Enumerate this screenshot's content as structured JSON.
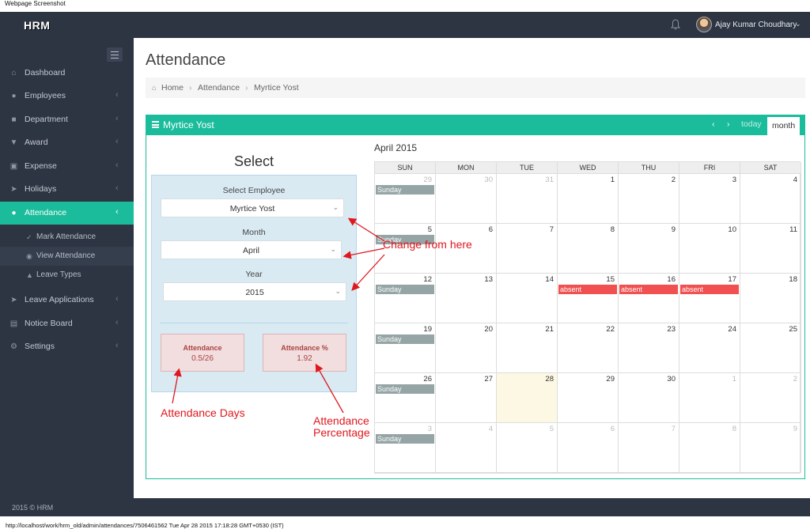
{
  "screenshot_caption": "Webpage Screenshot",
  "topbar": {
    "logo": "HRM",
    "user_name": "Ajay Kumar Choudhary"
  },
  "sidebar": {
    "items": [
      {
        "label": "Dashboard",
        "icon": "home-icon"
      },
      {
        "label": "Employees",
        "icon": "users-icon"
      },
      {
        "label": "Department",
        "icon": "briefcase-icon"
      },
      {
        "label": "Award",
        "icon": "trophy-icon"
      },
      {
        "label": "Expense",
        "icon": "money-icon"
      },
      {
        "label": "Holidays",
        "icon": "plane-icon"
      },
      {
        "label": "Attendance",
        "icon": "user-icon",
        "active": true
      },
      {
        "label": "Leave Applications",
        "icon": "rocket-icon"
      },
      {
        "label": "Notice Board",
        "icon": "clipboard-icon"
      },
      {
        "label": "Settings",
        "icon": "gears-icon"
      }
    ],
    "sub_items": [
      {
        "label": "Mark Attendance",
        "icon": "check-icon"
      },
      {
        "label": "View Attendance",
        "icon": "eye-icon",
        "current": true
      },
      {
        "label": "Leave Types",
        "icon": "sitemap-icon"
      }
    ],
    "footer": "2015 © HRM"
  },
  "page": {
    "title": "Attendance",
    "breadcrumb": [
      "Home",
      "Attendance",
      "Myrtice Yost"
    ]
  },
  "panel": {
    "title": "Myrtice Yost",
    "today_label": "today",
    "month_label": "month",
    "select": {
      "heading": "Select",
      "employee_label": "Select Employee",
      "employee_value": "Myrtice Yost",
      "month_label": "Month",
      "month_value": "April",
      "year_label": "Year",
      "year_value": "2015",
      "attendance_label": "Attendance",
      "attendance_value": "0.5/26",
      "percent_label": "Attendance %",
      "percent_value": "1.92"
    },
    "calendar": {
      "title": "April 2015",
      "weekdays": [
        "SUN",
        "MON",
        "TUE",
        "WED",
        "THU",
        "FRI",
        "SAT"
      ],
      "weeks": [
        [
          {
            "d": "29",
            "other": true,
            "ev": "Sunday",
            "type": "sunday"
          },
          {
            "d": "30",
            "other": true
          },
          {
            "d": "31",
            "other": true
          },
          {
            "d": "1"
          },
          {
            "d": "2"
          },
          {
            "d": "3"
          },
          {
            "d": "4"
          }
        ],
        [
          {
            "d": "5",
            "ev": "Sunday",
            "type": "sunday"
          },
          {
            "d": "6"
          },
          {
            "d": "7"
          },
          {
            "d": "8"
          },
          {
            "d": "9"
          },
          {
            "d": "10"
          },
          {
            "d": "11"
          }
        ],
        [
          {
            "d": "12",
            "ev": "Sunday",
            "type": "sunday"
          },
          {
            "d": "13"
          },
          {
            "d": "14"
          },
          {
            "d": "15",
            "ev": "absent",
            "type": "absent"
          },
          {
            "d": "16",
            "ev": "absent",
            "type": "absent"
          },
          {
            "d": "17",
            "ev": "absent",
            "type": "absent"
          },
          {
            "d": "18"
          }
        ],
        [
          {
            "d": "19",
            "ev": "Sunday",
            "type": "sunday"
          },
          {
            "d": "20"
          },
          {
            "d": "21"
          },
          {
            "d": "22"
          },
          {
            "d": "23"
          },
          {
            "d": "24"
          },
          {
            "d": "25"
          }
        ],
        [
          {
            "d": "26",
            "ev": "Sunday",
            "type": "sunday"
          },
          {
            "d": "27"
          },
          {
            "d": "28",
            "today": true
          },
          {
            "d": "29"
          },
          {
            "d": "30"
          },
          {
            "d": "1",
            "other": true
          },
          {
            "d": "2",
            "other": true
          }
        ],
        [
          {
            "d": "3",
            "other": true,
            "ev": "Sunday",
            "type": "sunday"
          },
          {
            "d": "4",
            "other": true
          },
          {
            "d": "5",
            "other": true
          },
          {
            "d": "6",
            "other": true
          },
          {
            "d": "7",
            "other": true
          },
          {
            "d": "8",
            "other": true
          },
          {
            "d": "9",
            "other": true
          }
        ]
      ]
    }
  },
  "annotations": {
    "change": "Change from here",
    "days": "Attendance Days",
    "percent_line1": "Attendance",
    "percent_line2": "Percentage",
    "color": "#e0171d"
  },
  "statusbar": "http://localhost/work/hrm_old/admin/attendances/7506461562 Tue Apr 28 2015 17:18:28 GMT+0530 (IST)"
}
